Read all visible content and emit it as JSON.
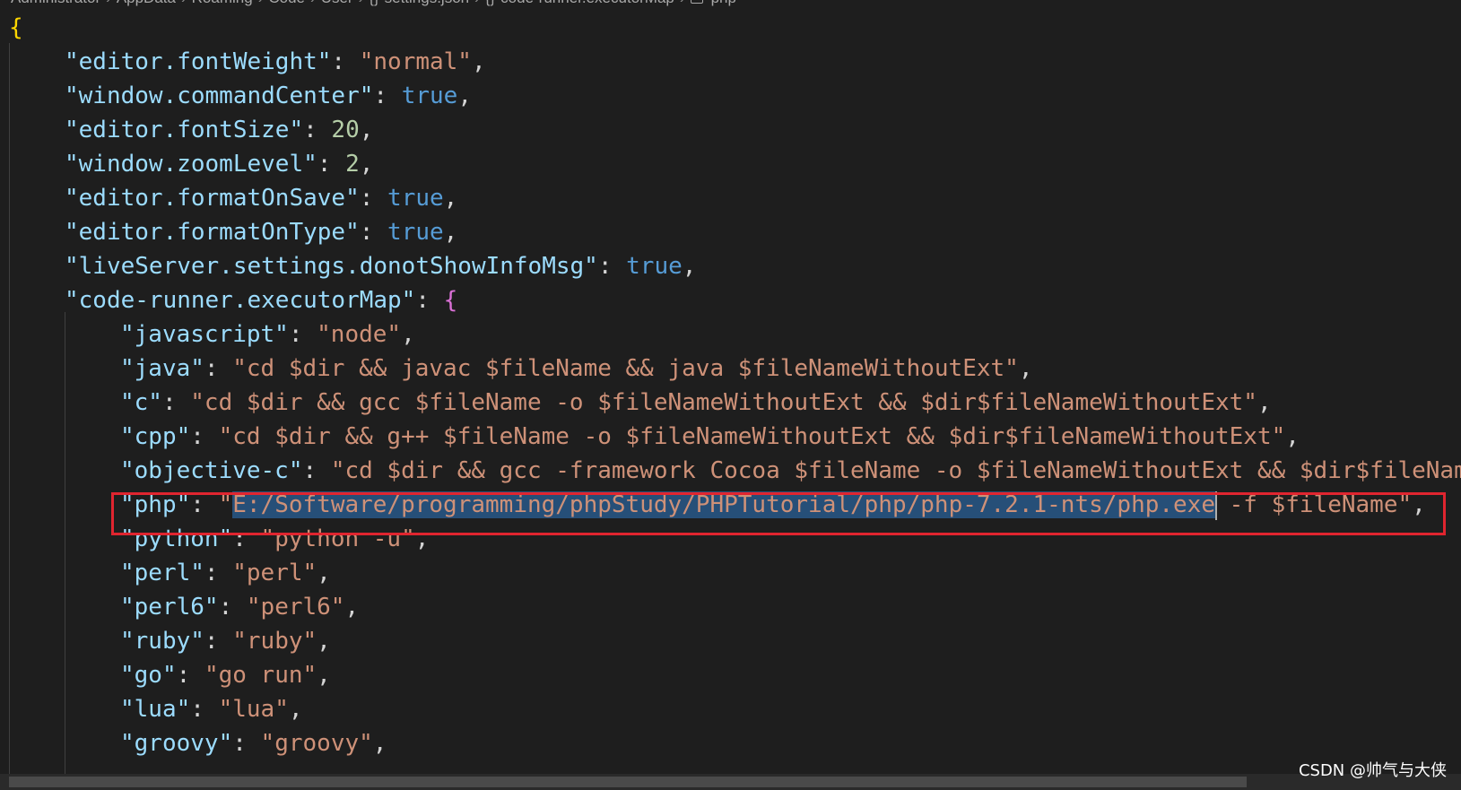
{
  "breadcrumb": [
    "Administrator",
    "AppData",
    "Roaming",
    "Code",
    "User",
    "settings.json",
    "code-runner.executorMap",
    "php"
  ],
  "settings": {
    "font_weight": {
      "key": "\"editor.fontWeight\"",
      "value": "\"normal\""
    },
    "command_center": {
      "key": "\"window.commandCenter\"",
      "value": "true"
    },
    "font_size": {
      "key": "\"editor.fontSize\"",
      "value": "20"
    },
    "zoom_level": {
      "key": "\"window.zoomLevel\"",
      "value": "2"
    },
    "format_on_save": {
      "key": "\"editor.formatOnSave\"",
      "value": "true"
    },
    "format_on_type": {
      "key": "\"editor.formatOnType\"",
      "value": "true"
    },
    "live_server": {
      "key": "\"liveServer.settings.donotShowInfoMsg\"",
      "value": "true"
    },
    "executor_map_key": "\"code-runner.executorMap\""
  },
  "executor_map": {
    "javascript": {
      "key": "\"javascript\"",
      "value": "\"node\""
    },
    "java": {
      "key": "\"java\"",
      "value": "\"cd $dir && javac $fileName && java $fileNameWithoutExt\""
    },
    "c": {
      "key": "\"c\"",
      "value": "\"cd $dir && gcc $fileName -o $fileNameWithoutExt && $dir$fileNameWithoutExt\""
    },
    "cpp": {
      "key": "\"cpp\"",
      "value": "\"cd $dir && g++ $fileName -o $fileNameWithoutExt && $dir$fileNameWithoutExt\""
    },
    "objective_c": {
      "key": "\"objective-c\"",
      "value": "\"cd $dir && gcc -framework Cocoa $fileName -o $fileNameWithoutExt && $dir$fileName"
    },
    "php": {
      "key": "\"php\"",
      "quote_open": "\"",
      "selected": "E:/Software/programming/phpStudy/PHPTutorial/php/php-7.2.1-nts/php.exe",
      "rest": " -f $fileName\""
    },
    "python": {
      "key": "\"python\"",
      "value": "\"python -u\""
    },
    "perl": {
      "key": "\"perl\"",
      "value": "\"perl\""
    },
    "perl6": {
      "key": "\"perl6\"",
      "value": "\"perl6\""
    },
    "ruby": {
      "key": "\"ruby\"",
      "value": "\"ruby\""
    },
    "go": {
      "key": "\"go\"",
      "value": "\"go run\""
    },
    "lua": {
      "key": "\"lua\"",
      "value": "\"lua\""
    },
    "groovy": {
      "key": "\"groovy\"",
      "value": "\"groovy\""
    }
  },
  "watermark": "CSDN @帅气与大侠"
}
